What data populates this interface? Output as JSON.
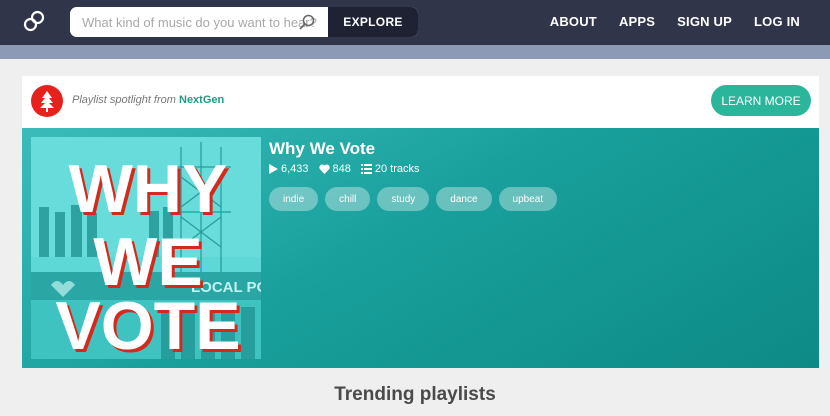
{
  "header": {
    "search_placeholder": "What kind of music do you want to hear?",
    "explore_label": "EXPLORE",
    "nav": [
      "ABOUT",
      "APPS",
      "SIGN UP",
      "LOG IN"
    ]
  },
  "spotlight": {
    "prefix": "Playlist spotlight from",
    "brand": "NextGen",
    "learn_more": "LEARN MORE"
  },
  "playlist": {
    "title": "Why We Vote",
    "plays": "6,433",
    "likes": "848",
    "tracks": "20 tracks",
    "tags": [
      "indie",
      "chill",
      "study",
      "dance",
      "upbeat"
    ],
    "cover_text": [
      "WHY",
      "WE",
      "VOTE"
    ],
    "cover_sign": "LOCAL POWER"
  },
  "sections": {
    "trending_title": "Trending playlists"
  },
  "colors": {
    "header_bg": "#313549",
    "accent": "#2bb69b",
    "hero_teal": "#19a09c",
    "brand_red": "#e5231c"
  }
}
